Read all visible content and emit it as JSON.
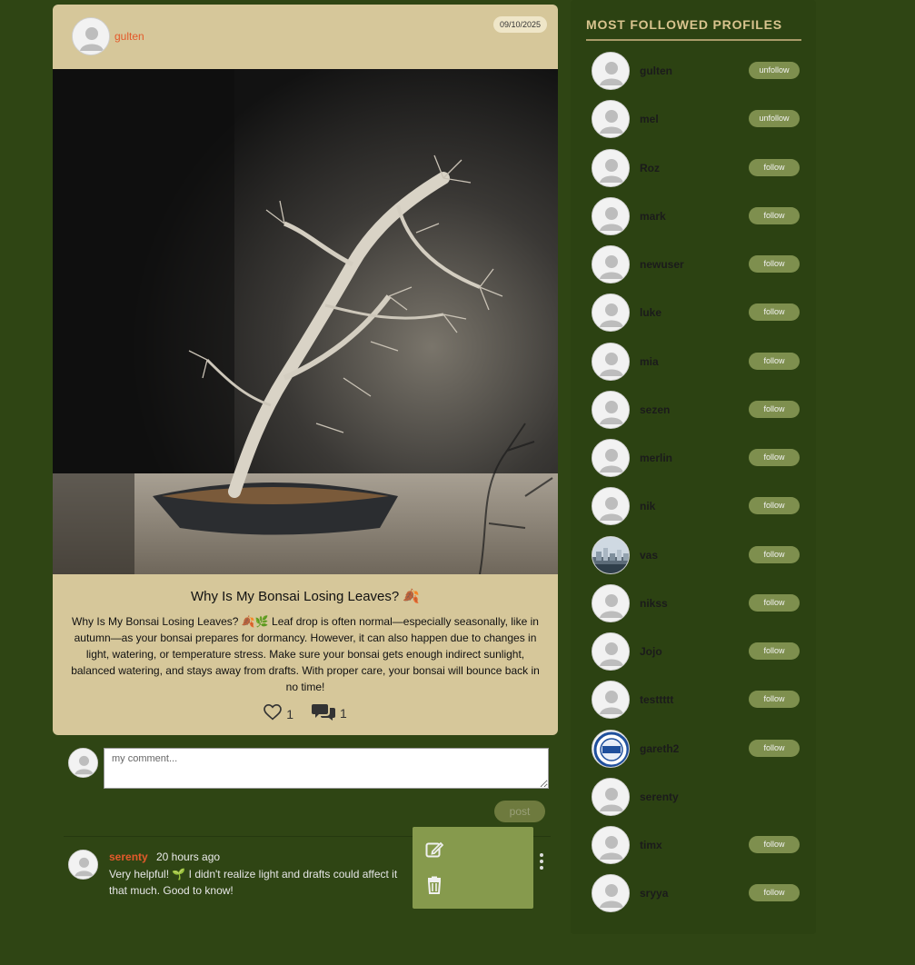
{
  "post": {
    "author": "gulten",
    "date": "09/10/2025",
    "title": "Why Is My Bonsai Losing Leaves? 🍂",
    "body": "Why Is My Bonsai Losing Leaves? 🍂🌿 Leaf drop is often normal—especially seasonally, like in autumn—as your bonsai prepares for dormancy. However, it can also happen due to changes in light, watering, or temperature stress. Make sure your bonsai gets enough indirect sunlight, balanced watering, and stays away from drafts. With proper care, your bonsai will bounce back in no time!",
    "likes": "1",
    "comments_count": "1"
  },
  "comment_form": {
    "placeholder": "my comment...",
    "post_label": "post"
  },
  "comments": [
    {
      "author": "serenty",
      "time": "20 hours ago",
      "text": "Very helpful! 🌱 I didn't realize light and drafts could affect it that much. Good to know!"
    }
  ],
  "sidebar": {
    "title": "MOST FOLLOWED PROFILES",
    "profiles": [
      {
        "name": "gulten",
        "button": "unfollow",
        "avatar": "default"
      },
      {
        "name": "mel",
        "button": "unfollow",
        "avatar": "default"
      },
      {
        "name": "Roz",
        "button": "follow",
        "avatar": "default"
      },
      {
        "name": "mark",
        "button": "follow",
        "avatar": "default"
      },
      {
        "name": "newuser",
        "button": "follow",
        "avatar": "default"
      },
      {
        "name": "luke",
        "button": "follow",
        "avatar": "default"
      },
      {
        "name": "mia",
        "button": "follow",
        "avatar": "default"
      },
      {
        "name": "sezen",
        "button": "follow",
        "avatar": "default"
      },
      {
        "name": "merlin",
        "button": "follow",
        "avatar": "default"
      },
      {
        "name": "nik",
        "button": "follow",
        "avatar": "default"
      },
      {
        "name": "vas",
        "button": "follow",
        "avatar": "photo-city"
      },
      {
        "name": "nikss",
        "button": "follow",
        "avatar": "default"
      },
      {
        "name": "Jojo",
        "button": "follow",
        "avatar": "default"
      },
      {
        "name": "testtttt",
        "button": "follow",
        "avatar": "default"
      },
      {
        "name": "gareth2",
        "button": "follow",
        "avatar": "badge-logo"
      },
      {
        "name": "serenty",
        "button": "",
        "avatar": "default"
      },
      {
        "name": "timx",
        "button": "follow",
        "avatar": "default"
      },
      {
        "name": "sryya",
        "button": "follow",
        "avatar": "default"
      }
    ]
  },
  "icons": {
    "heart": "heart-icon",
    "comments": "comments-icon",
    "edit": "edit-icon",
    "delete": "trash-icon",
    "more": "more-vertical-icon"
  },
  "colors": {
    "background": "#2f4514",
    "card": "#d6c79a",
    "accent": "#e35a2b",
    "button": "#7e8f4e"
  }
}
